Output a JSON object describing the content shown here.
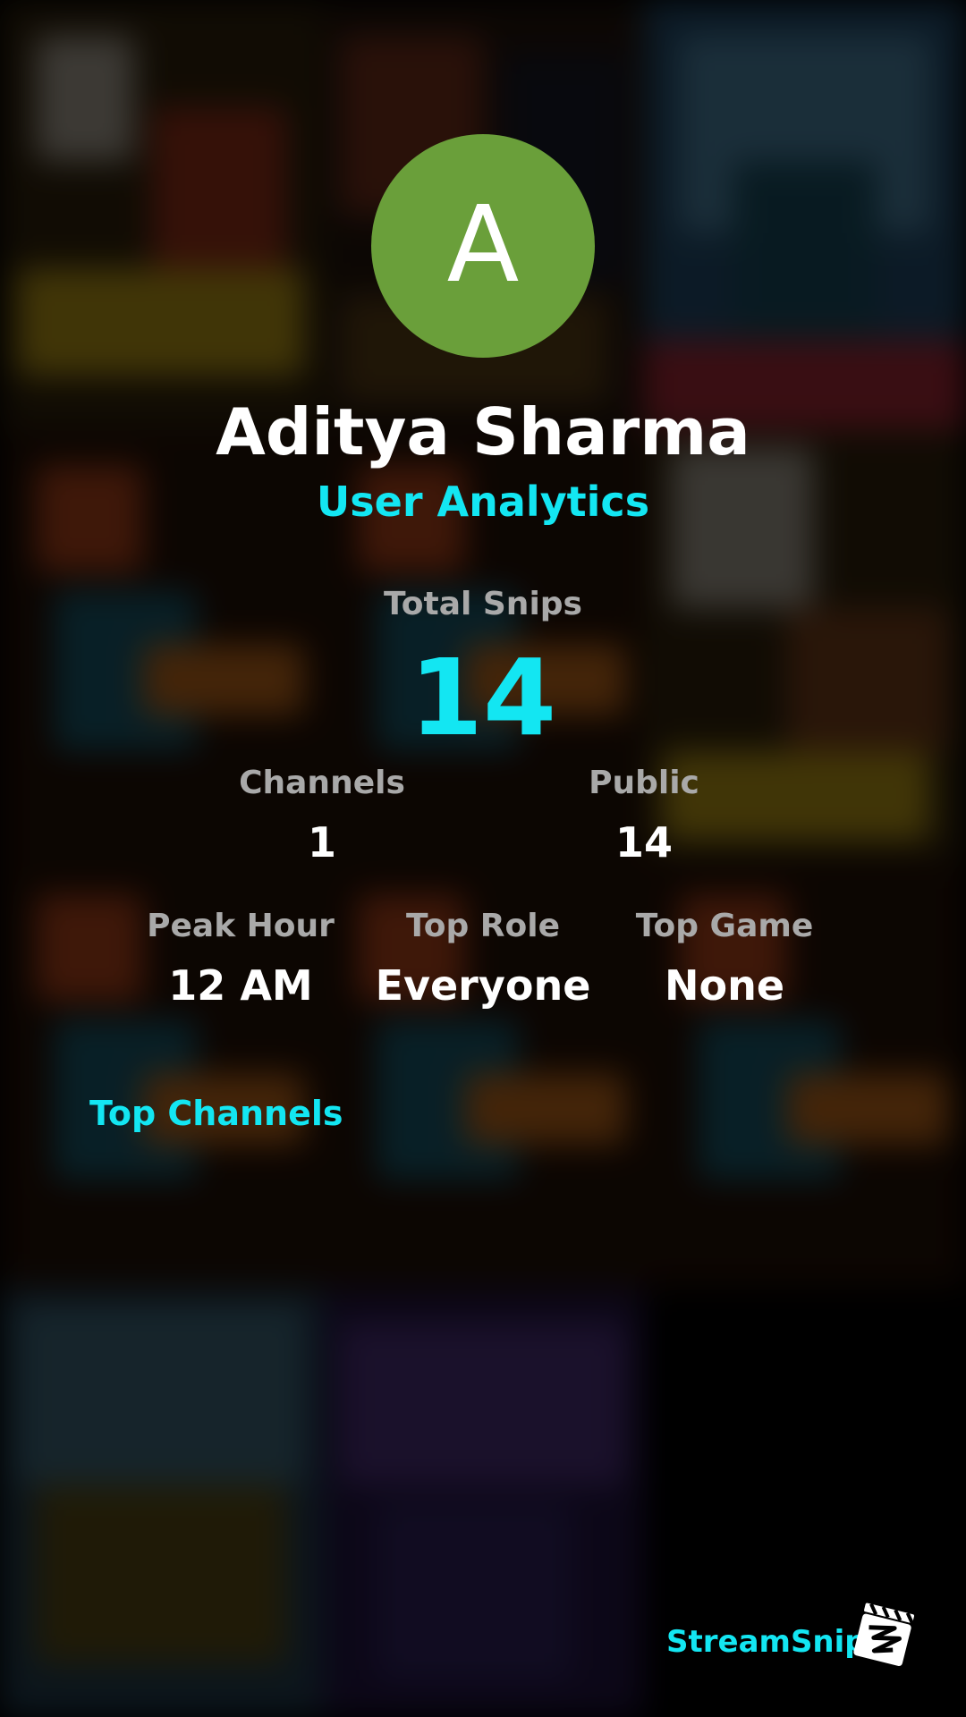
{
  "profile": {
    "avatar_letter": "A",
    "avatar_color": "#6a9f3a",
    "name": "Aditya Sharma",
    "subtitle": "User Analytics"
  },
  "stats": {
    "total_snips": {
      "label": "Total Snips",
      "value": "14"
    },
    "channels": {
      "label": "Channels",
      "value": "1"
    },
    "public": {
      "label": "Public",
      "value": "14"
    },
    "peak_hour": {
      "label": "Peak Hour",
      "value": "12 AM"
    },
    "top_role": {
      "label": "Top Role",
      "value": "Everyone"
    },
    "top_game": {
      "label": "Top Game",
      "value": "None"
    }
  },
  "sections": {
    "top_channels": "Top Channels"
  },
  "branding": {
    "name": "StreamSnip",
    "logo_icon": "clapperboard-icon"
  },
  "colors": {
    "accent": "#13e6f2",
    "label": "#a9a9a9",
    "value": "#ffffff",
    "background": "#000000"
  }
}
